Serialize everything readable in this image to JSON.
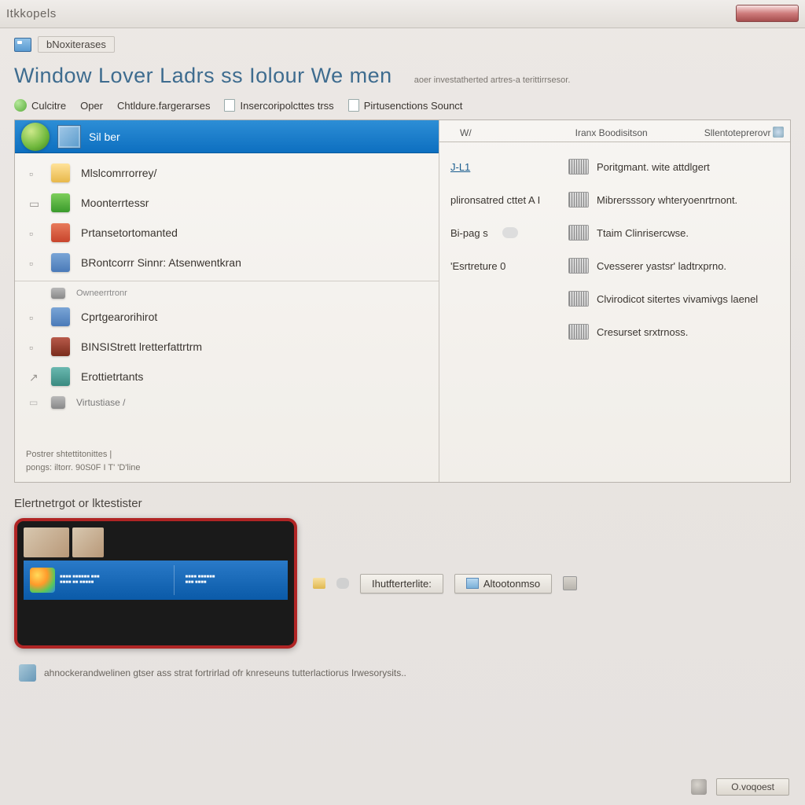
{
  "titlebar": {
    "title": "Itkkopels"
  },
  "breadcrumb": {
    "label": "bNoxiterases"
  },
  "page": {
    "title": "Window Lover Ladrs ss Iolour We men",
    "subtitle": "aoer investatherted artres-a terittirrsesor."
  },
  "toolbar": {
    "items": [
      {
        "label": "Culcitre"
      },
      {
        "label": "Oper"
      },
      {
        "label": "Chtldure.fargerarses"
      },
      {
        "label": "Insercoripolcttes  trss"
      },
      {
        "label": "Pirtusenctions Sounct"
      }
    ]
  },
  "selected": {
    "label": "Sil ber"
  },
  "list": [
    {
      "icon": "folder",
      "label": "Mlslcomrrorrey/"
    },
    {
      "icon": "green",
      "label": "Moonterrtessr"
    },
    {
      "icon": "red",
      "label": "Prtansetortomanted"
    },
    {
      "icon": "blue",
      "label": "BRontcorrr Sinnr: Atsenwentkran"
    },
    {
      "icon": "gray",
      "label": "Owneerrtronr"
    },
    {
      "icon": "blue",
      "label": "Cprtgearorihirot"
    },
    {
      "icon": "darkred",
      "label": "BINSIStrett lretterfattrtrm"
    },
    {
      "icon": "teal",
      "label": "Erottietrtants"
    },
    {
      "icon": "gray",
      "label": "Virtustiase /"
    }
  ],
  "list_footer": {
    "line1": "Postrer shtettitonittes |",
    "line2": "pongs: iltorr.   90S0F I    T' 'D'line"
  },
  "tabs": {
    "col1": "W/",
    "col2": "Iranx Boodisitson",
    "col3": "Sllentoteprerovr"
  },
  "left_links": [
    {
      "label": "J-L1"
    },
    {
      "label": "plironsatred cttet   A I"
    },
    {
      "label": "Bi-pag s"
    },
    {
      "label": "'Esrtreture 0"
    }
  ],
  "right_links": [
    {
      "label": "Poritgmant. wite attdlgert"
    },
    {
      "label": "Mibrersssory whteryoenrtrnont."
    },
    {
      "label": "Ttaim Clinrisercwse."
    },
    {
      "label": "Cvesserer yastsr' ladtrxprno."
    },
    {
      "label": "Clvirodicot sitertes vivamivgs laenel"
    },
    {
      "label": "Cresurset srxtrnoss."
    }
  ],
  "bottom": {
    "section_label": "Elertnetrgot or lktestister",
    "btn1": "Ihutfterterlite:",
    "btn2": "Altootonmso",
    "status": "ahnockerandwelinen gtser ass strat fortrirlad ofr knreseuns tutterlactiorus   Irwesorysits.."
  },
  "footer": {
    "button": "O.voqoest"
  }
}
